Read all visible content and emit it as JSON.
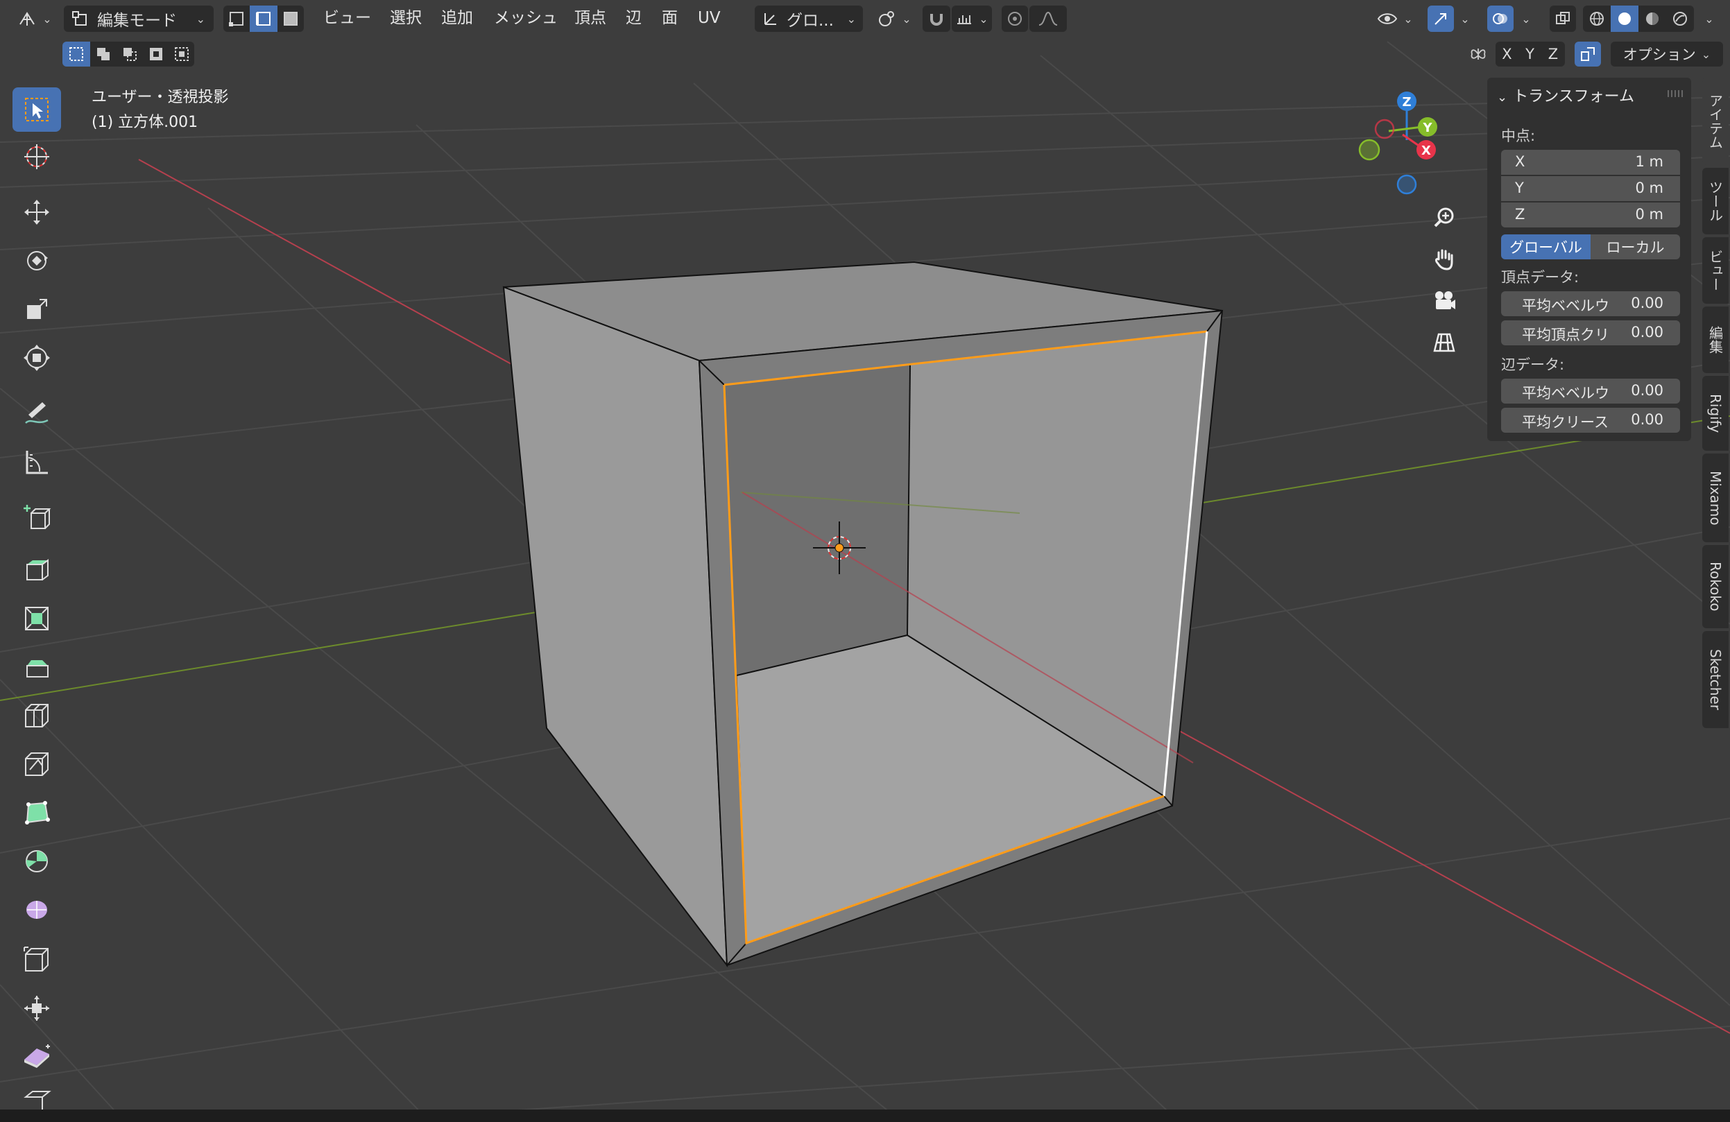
{
  "header": {
    "mode_label": "編集モード",
    "menus": [
      "ビュー",
      "選択",
      "追加",
      "メッシュ",
      "頂点",
      "辺",
      "面",
      "UV"
    ],
    "transform_orientation": "グロ...",
    "axis_labels": [
      "X",
      "Y",
      "Z"
    ],
    "options_label": "オプション"
  },
  "viewport": {
    "view_name": "ユーザー・透視投影",
    "object_name": "(1) 立方体.001"
  },
  "gizmo": {
    "z": "Z",
    "y": "Y",
    "x": "X"
  },
  "npanel": {
    "title": "トランスフォーム",
    "median_label": "中点:",
    "median": [
      {
        "axis": "X",
        "value": "1 m"
      },
      {
        "axis": "Y",
        "value": "0 m"
      },
      {
        "axis": "Z",
        "value": "0 m"
      }
    ],
    "global_label": "グローバル",
    "local_label": "ローカル",
    "vertex_data_label": "頂点データ:",
    "vertex_fields": [
      {
        "label": "平均ベベルウ",
        "value": "0.00"
      },
      {
        "label": "平均頂点クリ",
        "value": "0.00"
      }
    ],
    "edge_data_label": "辺データ:",
    "edge_fields": [
      {
        "label": "平均ベベルウ",
        "value": "0.00"
      },
      {
        "label": "平均クリース",
        "value": "0.00"
      }
    ]
  },
  "tabs": [
    "アイテム",
    "ツール",
    "ビュー",
    "編集",
    "Rigify",
    "Mixamo",
    "Rokoko",
    "Sketcher"
  ],
  "colors": {
    "accent": "#4772b3",
    "selection": "#ff9c1a",
    "x_axis": "#e8344a",
    "y_axis": "#86bd2a",
    "z_axis": "#2f7fd8"
  }
}
